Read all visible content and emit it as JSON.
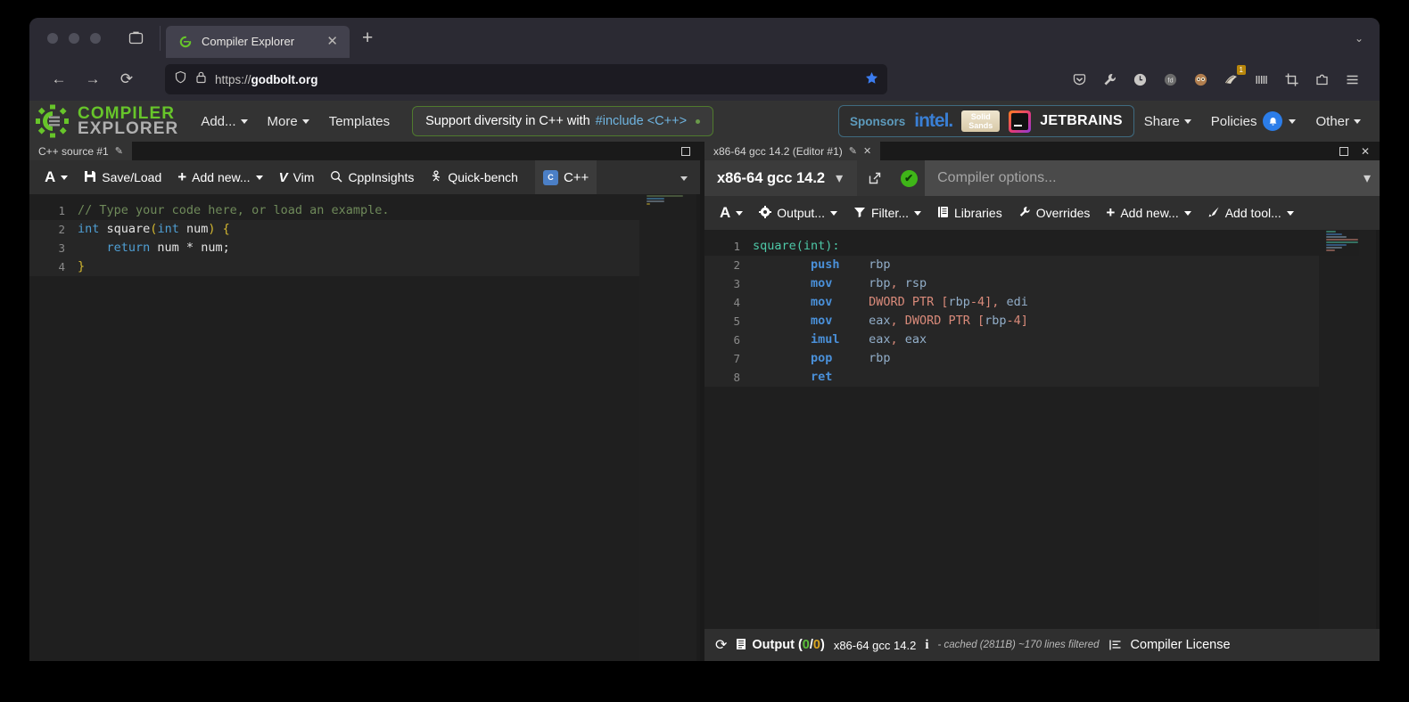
{
  "browser": {
    "tab": {
      "title": "Compiler Explorer",
      "favicon": "compiler-explorer-favicon",
      "close": "✕"
    },
    "new_tab": "+",
    "list_all_tabs": "⌄",
    "nav": {
      "back": "←",
      "forward": "→",
      "reload": "⟳"
    },
    "url": {
      "protocol": "https://",
      "domain": "godbolt.org",
      "shield_icon": "shield-icon",
      "lock_icon": "lock-icon",
      "bookmark_icon": "star-icon"
    },
    "extensions": [
      {
        "name": "pocket-icon",
        "glyph": "▽"
      },
      {
        "name": "wrench-icon",
        "glyph": "ᴏ"
      },
      {
        "name": "clock-extension-icon",
        "glyph": "ⓘ"
      },
      {
        "name": "fd-extension-icon",
        "glyph": "fd"
      },
      {
        "name": "raccoon-extension-icon",
        "glyph": "●"
      },
      {
        "name": "badger-extension-icon",
        "glyph": "◔",
        "badge": "1"
      },
      {
        "name": "barcode-extension-icon",
        "glyph": "|||"
      },
      {
        "name": "crop-extension-icon",
        "glyph": "⌗"
      },
      {
        "name": "puzzle-icon",
        "glyph": "❦"
      },
      {
        "name": "app-menu-icon",
        "glyph": "≡"
      }
    ]
  },
  "site": {
    "logo": {
      "line1": "COMPILER",
      "line2": "EXPLORER"
    },
    "nav": [
      {
        "label": "Add...",
        "caret": true
      },
      {
        "label": "More",
        "caret": true
      },
      {
        "label": "Templates",
        "caret": false
      }
    ],
    "banner": {
      "prefix": "Support diversity in C++ with ",
      "link": "#include <C++>"
    },
    "sponsors": {
      "label": "Sponsors",
      "items": [
        {
          "name": "intel",
          "text": "intel."
        },
        {
          "name": "solid-sands",
          "line1": "Solid",
          "line2": "Sands"
        },
        {
          "name": "jetbrains",
          "text": "JETBRAINS"
        }
      ]
    },
    "right_nav": [
      {
        "label": "Share",
        "caret": true,
        "bell": false
      },
      {
        "label": "Policies",
        "caret": true,
        "bell": true
      },
      {
        "label": "Other",
        "caret": true,
        "bell": false
      }
    ],
    "bell_glyph": "🔔"
  },
  "editor_pane": {
    "tab": {
      "title": "C++ source #1",
      "edit_icon": "✎"
    },
    "maximize_icon": "maximize-icon",
    "toolbar": [
      {
        "name": "font-size-button",
        "icon": "A",
        "label": "",
        "caret": true
      },
      {
        "name": "save-load-button",
        "icon": "💾",
        "label": "Save/Load",
        "caret": false
      },
      {
        "name": "add-new-button",
        "icon": "+",
        "label": "Add new...",
        "caret": true
      },
      {
        "name": "vim-button",
        "icon": "V",
        "label": "Vim",
        "caret": false
      },
      {
        "name": "cppinsights-button",
        "icon": "🔍",
        "label": "CppInsights",
        "caret": false
      },
      {
        "name": "quick-bench-button",
        "icon": "☂",
        "label": "Quick-bench",
        "caret": false
      }
    ],
    "language_selector": {
      "label": "C++",
      "icon": "C",
      "caret": true
    },
    "lines": [
      {
        "n": "1",
        "highlight": false,
        "tokens": [
          {
            "t": "// Type your code here, or load an example.",
            "c": "cmt"
          }
        ]
      },
      {
        "n": "2",
        "highlight": true,
        "tokens": [
          {
            "t": "int",
            "c": "kw"
          },
          {
            "t": " square",
            "c": "id"
          },
          {
            "t": "(",
            "c": "yl"
          },
          {
            "t": "int",
            "c": "kw"
          },
          {
            "t": " num",
            "c": "id"
          },
          {
            "t": ")",
            "c": "yl"
          },
          {
            "t": " ",
            "c": "id"
          },
          {
            "t": "{",
            "c": "yl"
          }
        ]
      },
      {
        "n": "3",
        "highlight": true,
        "tokens": [
          {
            "t": "    ",
            "c": "id"
          },
          {
            "t": "return",
            "c": "kw"
          },
          {
            "t": " num * num;",
            "c": "id"
          }
        ]
      },
      {
        "n": "4",
        "highlight": true,
        "tokens": [
          {
            "t": "}",
            "c": "yl"
          }
        ]
      }
    ]
  },
  "output_pane": {
    "tab": {
      "title": "x86-64 gcc 14.2 (Editor #1)",
      "edit_icon": "✎",
      "close_icon": "✕"
    },
    "maximize_icon": "maximize-icon",
    "close_icon": "✕",
    "compiler": {
      "name": "x86-64 gcc 14.2",
      "caret": "▾",
      "popout_icon": "↗",
      "status_icon": "✔"
    },
    "options": {
      "value": "",
      "placeholder": "Compiler options...",
      "caret": "▾"
    },
    "toolbar": [
      {
        "name": "font-size-button",
        "icon": "A",
        "label": "",
        "caret": true
      },
      {
        "name": "output-button",
        "icon": "⚙",
        "label": "Output...",
        "caret": true
      },
      {
        "name": "filter-button",
        "icon": "▼",
        "label": "Filter...",
        "caret": true
      },
      {
        "name": "libraries-button",
        "icon": "▤",
        "label": "Libraries",
        "caret": false
      },
      {
        "name": "overrides-button",
        "icon": "🔧",
        "label": "Overrides",
        "caret": false
      },
      {
        "name": "add-new-button",
        "icon": "+",
        "label": "Add new...",
        "caret": true
      },
      {
        "name": "add-tool-button",
        "icon": "✐",
        "label": "Add tool...",
        "caret": true
      }
    ],
    "lines": [
      {
        "n": "1",
        "highlight": false,
        "tokens": [
          {
            "t": "square(int):",
            "c": "asm-lbl"
          }
        ]
      },
      {
        "n": "2",
        "highlight": true,
        "tokens": [
          {
            "t": "        ",
            "c": "asm-reg"
          },
          {
            "t": "push",
            "c": "asm-mn"
          },
          {
            "t": "    ",
            "c": "asm-reg"
          },
          {
            "t": "rbp",
            "c": "asm-reg"
          }
        ]
      },
      {
        "n": "3",
        "highlight": true,
        "tokens": [
          {
            "t": "        ",
            "c": "asm-reg"
          },
          {
            "t": "mov",
            "c": "asm-mn"
          },
          {
            "t": "     ",
            "c": "asm-reg"
          },
          {
            "t": "rbp",
            "c": "asm-reg"
          },
          {
            "t": ", ",
            "c": "asm-dir"
          },
          {
            "t": "rsp",
            "c": "asm-reg"
          }
        ]
      },
      {
        "n": "4",
        "highlight": true,
        "tokens": [
          {
            "t": "        ",
            "c": "asm-reg"
          },
          {
            "t": "mov",
            "c": "asm-mn"
          },
          {
            "t": "     ",
            "c": "asm-reg"
          },
          {
            "t": "DWORD PTR ",
            "c": "asm-dir"
          },
          {
            "t": "[",
            "c": "asm-dir"
          },
          {
            "t": "rbp",
            "c": "asm-reg"
          },
          {
            "t": "-4], ",
            "c": "asm-dir"
          },
          {
            "t": "edi",
            "c": "asm-reg"
          }
        ]
      },
      {
        "n": "5",
        "highlight": true,
        "tokens": [
          {
            "t": "        ",
            "c": "asm-reg"
          },
          {
            "t": "mov",
            "c": "asm-mn"
          },
          {
            "t": "     ",
            "c": "asm-reg"
          },
          {
            "t": "eax",
            "c": "asm-reg"
          },
          {
            "t": ", ",
            "c": "asm-dir"
          },
          {
            "t": "DWORD PTR ",
            "c": "asm-dir"
          },
          {
            "t": "[",
            "c": "asm-dir"
          },
          {
            "t": "rbp",
            "c": "asm-reg"
          },
          {
            "t": "-4]",
            "c": "asm-dir"
          }
        ]
      },
      {
        "n": "6",
        "highlight": true,
        "tokens": [
          {
            "t": "        ",
            "c": "asm-reg"
          },
          {
            "t": "imul",
            "c": "asm-mn"
          },
          {
            "t": "    ",
            "c": "asm-reg"
          },
          {
            "t": "eax",
            "c": "asm-reg"
          },
          {
            "t": ", ",
            "c": "asm-dir"
          },
          {
            "t": "eax",
            "c": "asm-reg"
          }
        ]
      },
      {
        "n": "7",
        "highlight": true,
        "tokens": [
          {
            "t": "        ",
            "c": "asm-reg"
          },
          {
            "t": "pop",
            "c": "asm-mn"
          },
          {
            "t": "     ",
            "c": "asm-reg"
          },
          {
            "t": "rbp",
            "c": "asm-reg"
          }
        ]
      },
      {
        "n": "8",
        "highlight": true,
        "tokens": [
          {
            "t": "        ",
            "c": "asm-reg"
          },
          {
            "t": "ret",
            "c": "asm-mn"
          }
        ]
      }
    ],
    "status": {
      "reload_icon": "⟳",
      "output_icon": "▤",
      "output_label": "Output (",
      "output_errors": "0",
      "output_sep": "/",
      "output_warnings": "0",
      "output_close": ")",
      "compiler": "x86-64 gcc 14.2",
      "info_icon": "i",
      "cache_note": "- cached (2811B) ~170 lines filtered",
      "lines_icon": "≡",
      "license": "Compiler License"
    }
  },
  "colors": {
    "accent_green": "#67c52a",
    "link_blue": "#6fb4e0",
    "status_ok": "#3fb618",
    "bookmark_blue": "#3b7cf0"
  }
}
